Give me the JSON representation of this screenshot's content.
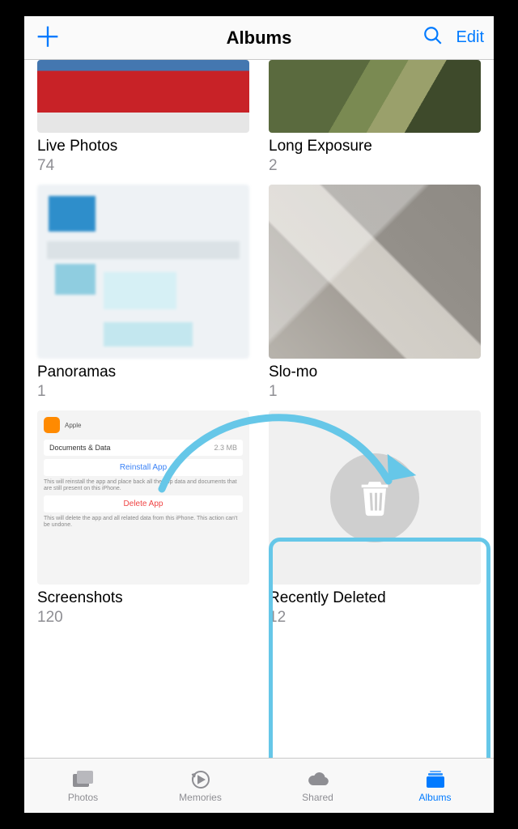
{
  "header": {
    "title": "Albums",
    "edit_label": "Edit"
  },
  "albums": [
    {
      "title": "Live Photos",
      "count": "74"
    },
    {
      "title": "Long Exposure",
      "count": "2"
    },
    {
      "title": "Panoramas",
      "count": "1"
    },
    {
      "title": "Slo-mo",
      "count": "1"
    },
    {
      "title": "Screenshots",
      "count": "120"
    },
    {
      "title": "Recently Deleted",
      "count": "12"
    }
  ],
  "screenshot_preview": {
    "app_vendor": "Apple",
    "row_label": "Documents & Data",
    "row_value": "2.3 MB",
    "reinstall_label": "Reinstall App",
    "reinstall_note": "This will reinstall the app and place back all the app data and documents that are still present on this iPhone.",
    "delete_label": "Delete App",
    "delete_note": "This will delete the app and all related data from this iPhone. This action can't be undone."
  },
  "tabs": {
    "photos": "Photos",
    "memories": "Memories",
    "shared": "Shared",
    "albums": "Albums"
  }
}
